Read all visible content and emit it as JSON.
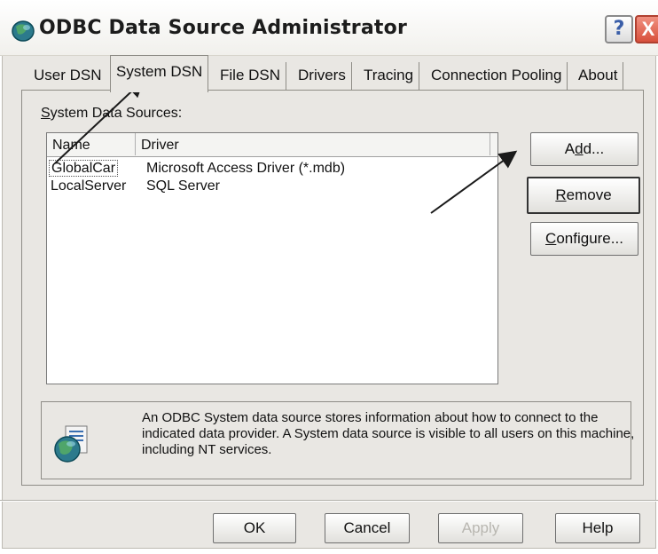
{
  "window": {
    "title": "ODBC Data Source Administrator",
    "help_label": "?",
    "close_label": "X"
  },
  "tabs": [
    {
      "label": "User DSN"
    },
    {
      "label": "System DSN",
      "active": true
    },
    {
      "label": "File DSN"
    },
    {
      "label": "Drivers"
    },
    {
      "label": "Tracing"
    },
    {
      "label": "Connection Pooling"
    },
    {
      "label": "About"
    }
  ],
  "system_dsn": {
    "group_label_first": "S",
    "group_label_rest": "ystem Data Sources:",
    "columns": [
      "Name",
      "Driver"
    ],
    "rows": [
      {
        "name": "GlobalCar",
        "driver": "Microsoft Access Driver (*.mdb)",
        "selected": true
      },
      {
        "name": "LocalServer",
        "driver": "SQL Server"
      }
    ],
    "buttons": {
      "add": {
        "pre": "A",
        "u": "d",
        "post": "d..."
      },
      "remove": {
        "pre": "",
        "u": "R",
        "post": "emove"
      },
      "configure": {
        "pre": "",
        "u": "C",
        "post": "onfigure..."
      }
    },
    "info_text": "An ODBC System data source stores information about how to connect to the indicated data provider.  A System data source is visible to all users on this machine, including NT services."
  },
  "footer": {
    "ok_label": "OK",
    "cancel_label": "Cancel",
    "apply_label": "Apply",
    "help_label": "Help"
  },
  "colors": {
    "dialog_bg": "#e9e7e3",
    "close_button": "#d8503c",
    "list_bg": "#ffffff"
  }
}
